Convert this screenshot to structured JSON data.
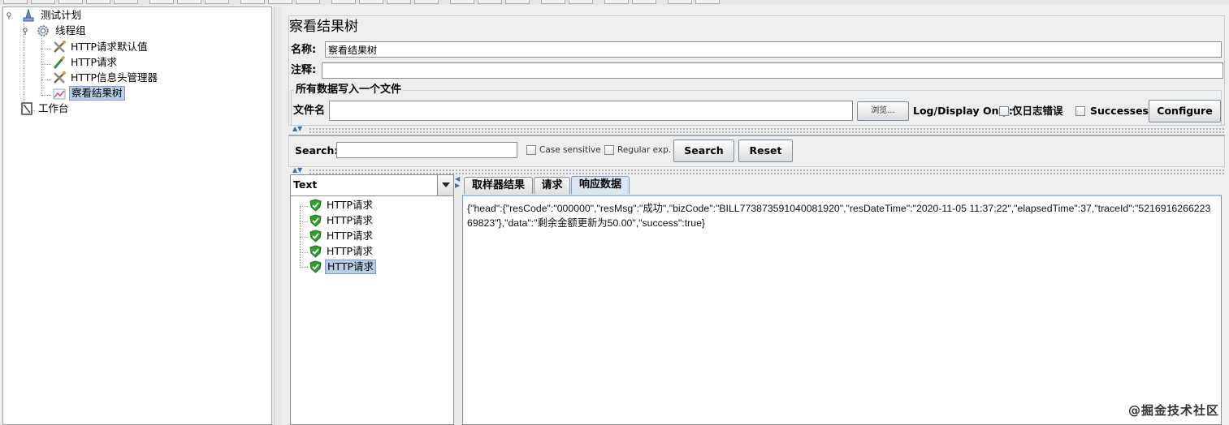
{
  "tree": {
    "nodes": [
      {
        "label": "测试计划",
        "icon": "test-plan-icon"
      },
      {
        "label": "线程组",
        "icon": "gear-icon"
      },
      {
        "label": "HTTP请求默认值",
        "icon": "wrench-icon"
      },
      {
        "label": "HTTP请求",
        "icon": "pipette-icon"
      },
      {
        "label": "HTTP信息头管理器",
        "icon": "wrench-icon"
      },
      {
        "label": "察看结果树",
        "icon": "graph-icon"
      },
      {
        "label": "工作台",
        "icon": "workbench-icon"
      }
    ]
  },
  "panel": {
    "title": "察看结果树",
    "name_label": "名称:",
    "name_value": "察看结果树",
    "comment_label": "注释:",
    "comment_value": "",
    "file_section_title": "所有数据写入一个文件",
    "file_label": "文件名",
    "file_value": "",
    "browse_label": "浏览...",
    "log_display_label": "Log/Display Only:",
    "errors_only_label": "仅日志错误",
    "successes_label": "Successes",
    "configure_label": "Configure"
  },
  "search": {
    "label": "Search:",
    "value": "",
    "case_sensitive_label": "Case sensitive",
    "regex_label": "Regular exp.",
    "search_button": "Search",
    "reset_button": "Reset"
  },
  "results": {
    "renderer_selected": "Text",
    "items": [
      "HTTP请求",
      "HTTP请求",
      "HTTP请求",
      "HTTP请求",
      "HTTP请求"
    ],
    "selected_index": 4,
    "status_color": "#2e9e2e"
  },
  "tabs": [
    "取样器结果",
    "请求",
    "响应数据"
  ],
  "active_tab_index": 2,
  "response_text": "{\"head\":{\"resCode\":\"000000\",\"resMsg\":\"成功\",\"bizCode\":\"BILL773873591040081920\",\"resDateTime\":\"2020-11-05 11:37:22\",\"elapsedTime\":37,\"traceId\":\"521691626622369823\"},\"data\":\"剩余金额更新为50.00\",\"success\":true}",
  "watermark": "@掘金技术社区"
}
